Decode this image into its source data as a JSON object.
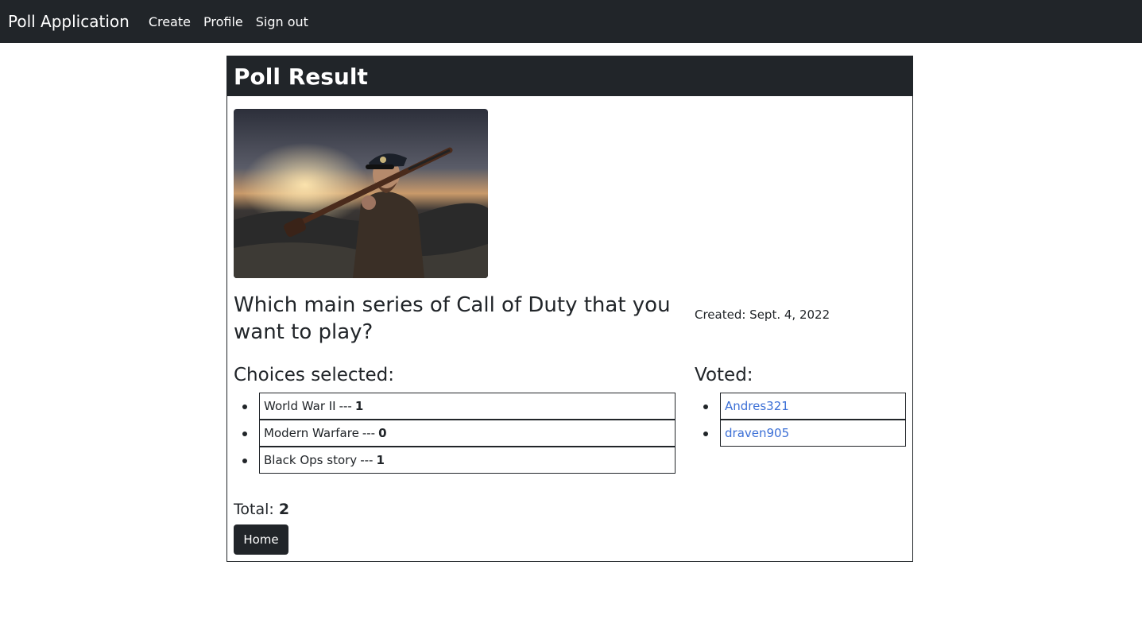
{
  "navbar": {
    "brand": "Poll Application",
    "links": [
      "Create",
      "Profile",
      "Sign out"
    ]
  },
  "card": {
    "title": "Poll Result",
    "image": "soldier-with-rifle-photo",
    "question": "Which main series of Call of Duty that you want to play?",
    "created": "Created: Sept. 4, 2022",
    "choices_heading": "Choices selected:",
    "choices": [
      {
        "label": "World War II",
        "separator": "---",
        "count": "1"
      },
      {
        "label": "Modern Warfare",
        "separator": "---",
        "count": "0"
      },
      {
        "label": "Black Ops story",
        "separator": "---",
        "count": "1"
      }
    ],
    "voted_heading": "Voted:",
    "voters": [
      "Andres321",
      "draven905"
    ],
    "total_label": "Total:",
    "total_value": "2",
    "home_button": "Home"
  },
  "colors": {
    "dark": "#212529",
    "link": "#3b6fd6"
  }
}
